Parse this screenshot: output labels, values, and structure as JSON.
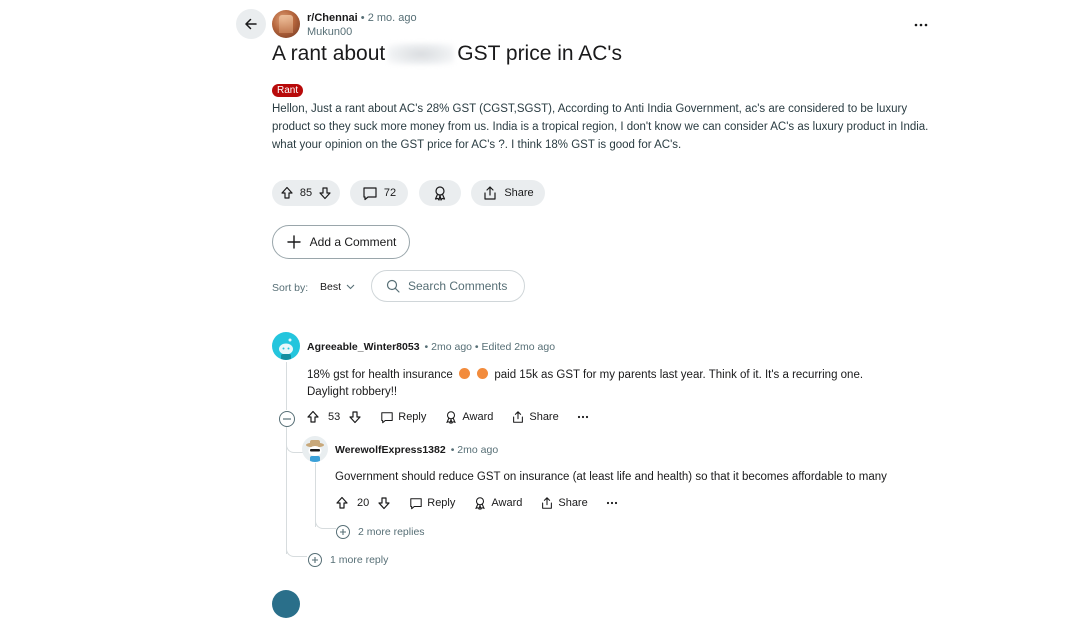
{
  "post": {
    "subreddit": "r/Chennai",
    "time": "• 2 mo. ago",
    "author": "Mukun00",
    "title_before": "A rant about",
    "title_after": "GST price in AC's",
    "flair": "Rant",
    "body": "Hellon, Just a rant about AC's 28% GST (CGST,SGST), According to Anti India Government, ac's are considered to be luxury product so they suck more money from us. India is a tropical region, I don't know we can consider AC's as luxury product in India. what your opinion on the GST price for AC's ?. I think 18% GST is good for AC's.",
    "upvotes": "85",
    "comments": "72",
    "share_label": "Share"
  },
  "add_comment_label": "Add a Comment",
  "sort": {
    "label": "Sort by:",
    "value": "Best"
  },
  "search": {
    "placeholder": "Search Comments"
  },
  "comments": [
    {
      "user": "Agreeable_Winter8053",
      "meta": "• 2mo ago • Edited 2mo ago",
      "text_a": "18% gst for health insurance",
      "text_b": "paid 15k as GST for my parents last year. Think of it. It's a recurring one. Daylight robbery!!",
      "votes": "53",
      "reply_label": "Reply",
      "award_label": "Award",
      "share_label": "Share",
      "more_replies": "1 more reply"
    },
    {
      "user": "WerewolfExpress1382",
      "meta": "• 2mo ago",
      "text": "Government should reduce GST on insurance (at least life and health) so that it becomes affordable to many",
      "votes": "20",
      "reply_label": "Reply",
      "award_label": "Award",
      "share_label": "Share",
      "more_replies": "2 more replies"
    }
  ],
  "colors": {
    "flair_bg": "#b80a0a",
    "pill_bg": "#eaedef",
    "avatar_teal": "#24c5dd"
  }
}
